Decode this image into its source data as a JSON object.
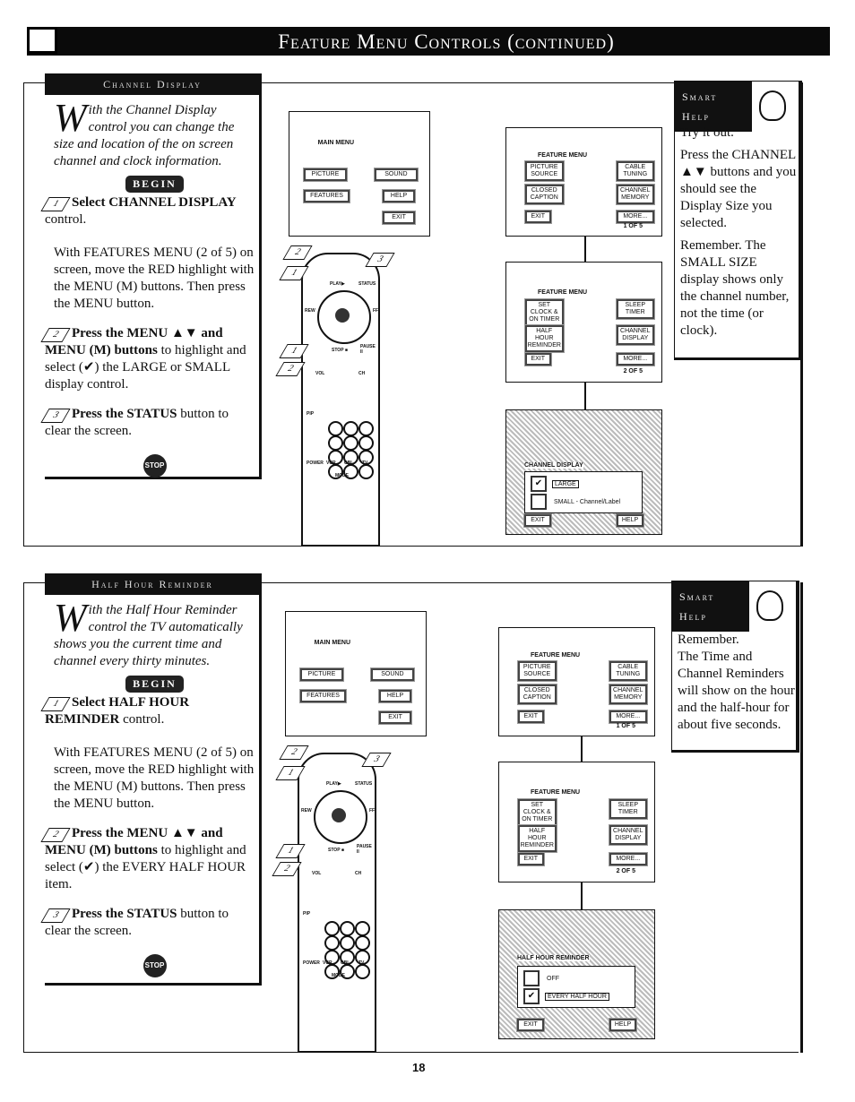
{
  "header": {
    "title": "Feature Menu Controls (continued)"
  },
  "sections": [
    {
      "tab": "Channel Display",
      "intro": "ith the Channel Display control you can change the size and location of the on screen channel and clock information.",
      "dropcap": "W",
      "begin": "BEGIN",
      "step1_bold": "Select CHANNEL DISPLAY",
      "step1_rest": " control.",
      "para": "With FEATURES MENU (2 of 5) on screen, move the RED highlight with the MENU (M) buttons. Then press the MENU button.",
      "step2_bold": "Press the MENU ▲▼ and MENU (M) buttons",
      "step2_rest": " to highlight and select (✔) the LARGE or SMALL display control.",
      "step3_bold": "Press the STATUS",
      "step3_rest": " button to clear the screen.",
      "stop": "STOP",
      "help_tab1": "Smart",
      "help_tab2": "Help",
      "help_text": [
        "Try it out.",
        "Press the CHANNEL ▲▼ buttons and you should see the Display Size you selected.",
        "Remember. The SMALL SIZE display shows only the channel number, not the time (or clock)."
      ],
      "screen3": {
        "title": "CHANNEL DISPLAY",
        "opt1": "LARGE",
        "opt2": "SMALL - Channel/Label",
        "exit": "EXIT",
        "help": "HELP"
      }
    },
    {
      "tab": "Half Hour Reminder",
      "intro": "ith the Half Hour Reminder control the TV automatically shows you the current time and channel every thirty minutes.",
      "dropcap": "W",
      "begin": "BEGIN",
      "step1_bold": "Select HALF HOUR REMINDER",
      "step1_rest": " control.",
      "para": "With FEATURES MENU (2 of 5) on screen, move the RED highlight with the MENU (M) buttons. Then press the MENU button.",
      "step2_bold": "Press the MENU ▲▼ and MENU (M) buttons",
      "step2_rest": " to highlight and select (✔) the EVERY HALF HOUR item.",
      "step3_bold": "Press the STATUS",
      "step3_rest": " button to clear the screen.",
      "stop": "STOP",
      "help_tab1": "Smart",
      "help_tab2": "Help",
      "help_text": [
        "Remember.",
        "The Time and Channel Reminders will show on the hour and the half-hour for about five seconds."
      ],
      "screen3": {
        "title": "HALF HOUR REMINDER",
        "opt1": "OFF",
        "opt2": "EVERY HALF HOUR",
        "exit": "EXIT",
        "help": "HELP"
      }
    }
  ],
  "main_menu": {
    "title": "MAIN MENU",
    "items": [
      "PICTURE",
      "SOUND",
      "FEATURES",
      "HELP",
      "EXIT"
    ]
  },
  "feature_menu1": {
    "title": "FEATURE MENU",
    "items": [
      "PICTURE SOURCE",
      "CABLE TUNING",
      "CLOSED CAPTION",
      "CHANNEL MEMORY",
      "EXIT",
      "MORE..."
    ],
    "page": "1 OF 5"
  },
  "feature_menu2": {
    "title": "FEATURE MENU",
    "items": [
      "SET CLOCK & ON TIMER",
      "SLEEP TIMER",
      "HALF HOUR REMINDER",
      "CHANNEL DISPLAY",
      "EXIT",
      "MORE..."
    ],
    "page": "2 OF 5"
  },
  "remote": {
    "labels": [
      "PLAY▶",
      "STATUS",
      "REW",
      "FF",
      "STOP ■",
      "PAUSE II",
      "VOL",
      "CH",
      "PIP",
      "POWER",
      "VCR",
      "CBL",
      "TV",
      "MODE"
    ],
    "callouts": [
      "1",
      "2",
      "3"
    ]
  },
  "page_number": "18"
}
